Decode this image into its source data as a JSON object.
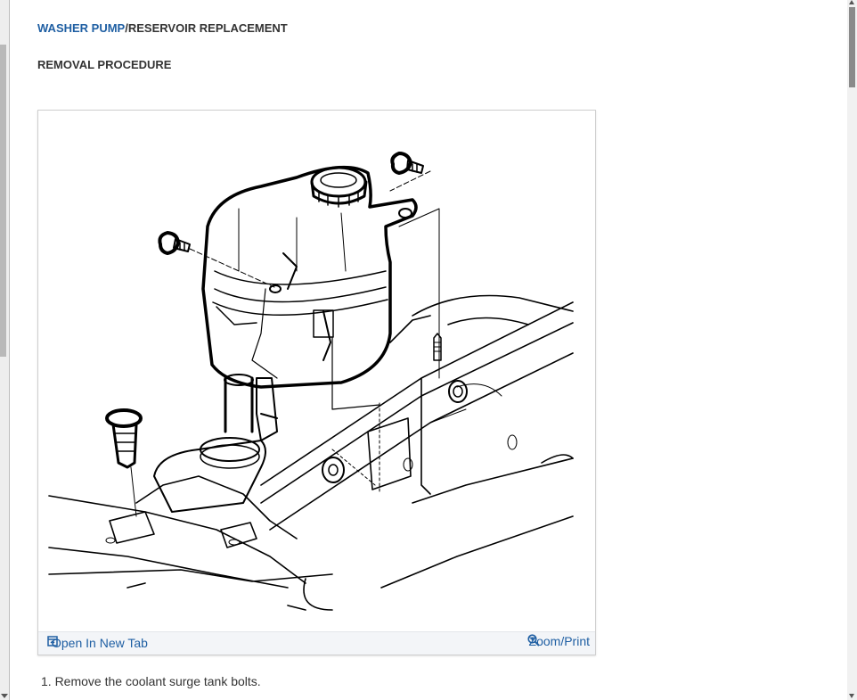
{
  "document": {
    "title_link": "WASHER PUMP",
    "title_rest": "/RESERVOIR REPLACEMENT",
    "subheading": "REMOVAL PROCEDURE",
    "steps": [
      "1. Remove the coolant surge tank bolts."
    ]
  },
  "figure": {
    "open_tab_label": "Open In New Tab",
    "zoom_label": "Zoom/Print",
    "icons": {
      "open_tab": "open-new-tab-icon",
      "zoom": "zoom-in-icon"
    },
    "accent_color": "#1f5fa3"
  }
}
